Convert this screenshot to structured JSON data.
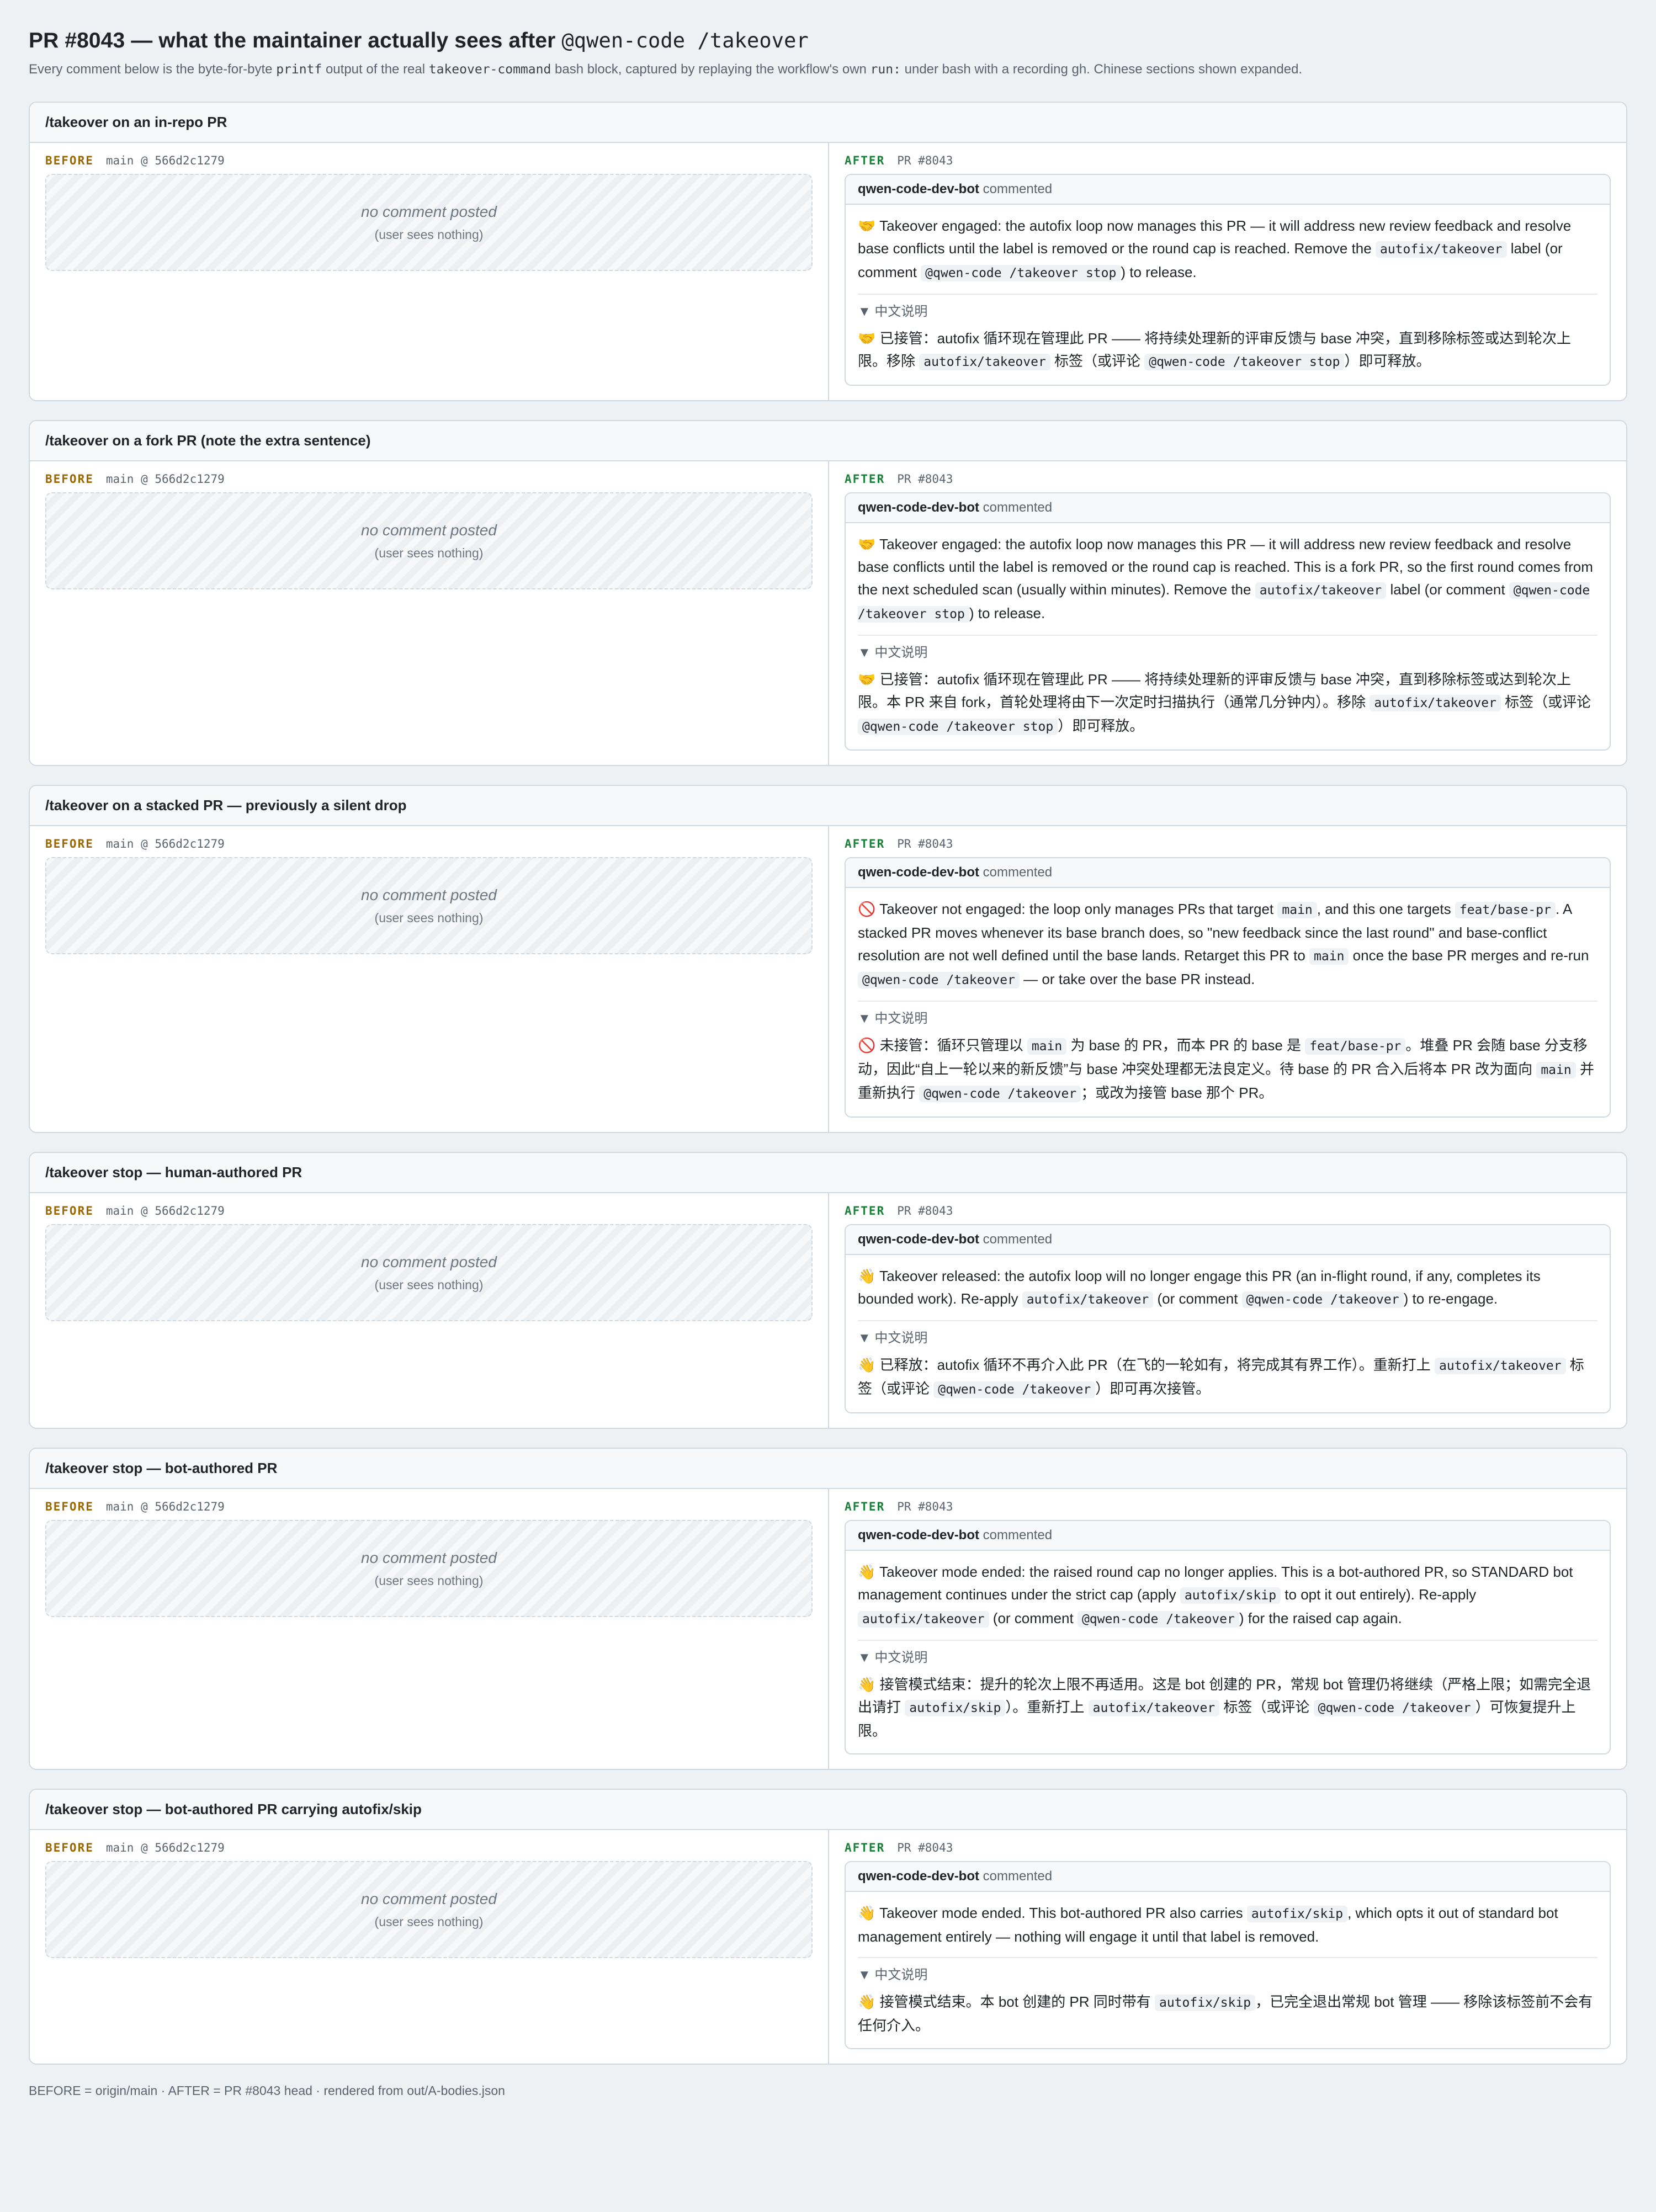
{
  "header": {
    "title_prefix": "PR #8043 — what the maintainer actually sees after",
    "title_code": "@qwen-code /takeover",
    "subtitle_1": "Every comment below is the byte-for-byte",
    "subtitle_code_1": "printf",
    "subtitle_2": "output of the real",
    "subtitle_code_2": "takeover-command",
    "subtitle_3": "bash block, captured by replaying the workflow's own",
    "subtitle_code_3": "run:",
    "subtitle_4": "under bash with a recording gh. Chinese sections shown expanded."
  },
  "labels": {
    "before": "BEFORE",
    "before_ref": "main @ 566d2c1279",
    "after": "AFTER",
    "after_ref": "PR #8043",
    "empty_title": "no comment posted",
    "empty_sub": "(user sees nothing)",
    "author": "qwen-code-dev-bot",
    "verb": "commented",
    "details_toggle": "▼ 中文说明"
  },
  "scenarios": [
    {
      "title": "/takeover on an in-repo PR",
      "en": [
        {
          "t": "🤝 Takeover engaged: the autofix loop now manages this PR — it will address new review feedback and resolve base conflicts until the label is removed or the round cap is reached. Remove the "
        },
        {
          "c": "autofix/takeover"
        },
        {
          "t": " label (or comment "
        },
        {
          "c": "@qwen-code /takeover stop"
        },
        {
          "t": ") to release."
        }
      ],
      "zh": [
        {
          "t": "🤝 已接管：autofix 循环现在管理此 PR —— 将持续处理新的评审反馈与 base 冲突，直到移除标签或达到轮次上限。移除 "
        },
        {
          "c": "autofix/takeover"
        },
        {
          "t": " 标签（或评论 "
        },
        {
          "c": "@qwen-code /takeover stop"
        },
        {
          "t": "）即可释放。"
        }
      ]
    },
    {
      "title": "/takeover on a fork PR (note the extra sentence)",
      "en": [
        {
          "t": "🤝 Takeover engaged: the autofix loop now manages this PR — it will address new review feedback and resolve base conflicts until the label is removed or the round cap is reached. This is a fork PR, so the first round comes from the next scheduled scan (usually within minutes). Remove the "
        },
        {
          "c": "autofix/takeover"
        },
        {
          "t": " label (or comment "
        },
        {
          "c": "@qwen-code /takeover stop"
        },
        {
          "t": ") to release."
        }
      ],
      "zh": [
        {
          "t": "🤝 已接管：autofix 循环现在管理此 PR —— 将持续处理新的评审反馈与 base 冲突，直到移除标签或达到轮次上限。本 PR 来自 fork，首轮处理将由下一次定时扫描执行（通常几分钟内）。移除 "
        },
        {
          "c": "autofix/takeover"
        },
        {
          "t": " 标签（或评论 "
        },
        {
          "c": "@qwen-code /takeover stop"
        },
        {
          "t": "）即可释放。"
        }
      ]
    },
    {
      "title": "/takeover on a stacked PR — previously a silent drop",
      "en": [
        {
          "t": "🚫 Takeover not engaged: the loop only manages PRs that target "
        },
        {
          "c": "main"
        },
        {
          "t": ", and this one targets "
        },
        {
          "c": "feat/base-pr"
        },
        {
          "t": ". A stacked PR moves whenever its base branch does, so \"new feedback since the last round\" and base-conflict resolution are not well defined until the base lands. Retarget this PR to "
        },
        {
          "c": "main"
        },
        {
          "t": " once the base PR merges and re-run "
        },
        {
          "c": "@qwen-code /takeover"
        },
        {
          "t": " — or take over the base PR instead."
        }
      ],
      "zh": [
        {
          "t": "🚫 未接管：循环只管理以 "
        },
        {
          "c": "main"
        },
        {
          "t": " 为 base 的 PR，而本 PR 的 base 是 "
        },
        {
          "c": "feat/base-pr"
        },
        {
          "t": "。堆叠 PR 会随 base 分支移动，因此“自上一轮以来的新反馈”与 base 冲突处理都无法良定义。待 base 的 PR 合入后将本 PR 改为面向 "
        },
        {
          "c": "main"
        },
        {
          "t": " 并重新执行 "
        },
        {
          "c": "@qwen-code /takeover"
        },
        {
          "t": "；或改为接管 base 那个 PR。"
        }
      ]
    },
    {
      "title": "/takeover stop — human-authored PR",
      "en": [
        {
          "t": "👋 Takeover released: the autofix loop will no longer engage this PR (an in-flight round, if any, completes its bounded work). Re-apply "
        },
        {
          "c": "autofix/takeover"
        },
        {
          "t": " (or comment "
        },
        {
          "c": "@qwen-code /takeover"
        },
        {
          "t": ") to re-engage."
        }
      ],
      "zh": [
        {
          "t": "👋 已释放：autofix 循环不再介入此 PR（在飞的一轮如有，将完成其有界工作）。重新打上 "
        },
        {
          "c": "autofix/takeover"
        },
        {
          "t": " 标签（或评论 "
        },
        {
          "c": "@qwen-code /takeover"
        },
        {
          "t": "）即可再次接管。"
        }
      ]
    },
    {
      "title": "/takeover stop — bot-authored PR",
      "en": [
        {
          "t": "👋 Takeover mode ended: the raised round cap no longer applies. This is a bot-authored PR, so STANDARD bot management continues under the strict cap (apply "
        },
        {
          "c": "autofix/skip"
        },
        {
          "t": " to opt it out entirely). Re-apply "
        },
        {
          "c": "autofix/takeover"
        },
        {
          "t": " (or comment "
        },
        {
          "c": "@qwen-code /takeover"
        },
        {
          "t": ") for the raised cap again."
        }
      ],
      "zh": [
        {
          "t": "👋 接管模式结束：提升的轮次上限不再适用。这是 bot 创建的 PR，常规 bot 管理仍将继续（严格上限；如需完全退出请打 "
        },
        {
          "c": "autofix/skip"
        },
        {
          "t": "）。重新打上 "
        },
        {
          "c": "autofix/takeover"
        },
        {
          "t": " 标签（或评论 "
        },
        {
          "c": "@qwen-code /takeover"
        },
        {
          "t": "）可恢复提升上限。"
        }
      ]
    },
    {
      "title": "/takeover stop — bot-authored PR carrying autofix/skip",
      "en": [
        {
          "t": "👋 Takeover mode ended. This bot-authored PR also carries "
        },
        {
          "c": "autofix/skip"
        },
        {
          "t": ", which opts it out of standard bot management entirely — nothing will engage it until that label is removed."
        }
      ],
      "zh": [
        {
          "t": "👋 接管模式结束。本 bot 创建的 PR 同时带有 "
        },
        {
          "c": "autofix/skip"
        },
        {
          "t": "，已完全退出常规 bot 管理 —— 移除该标签前不会有任何介入。"
        }
      ]
    }
  ],
  "footer": "BEFORE = origin/main · AFTER = PR #8043 head · rendered from out/A-bodies.json"
}
